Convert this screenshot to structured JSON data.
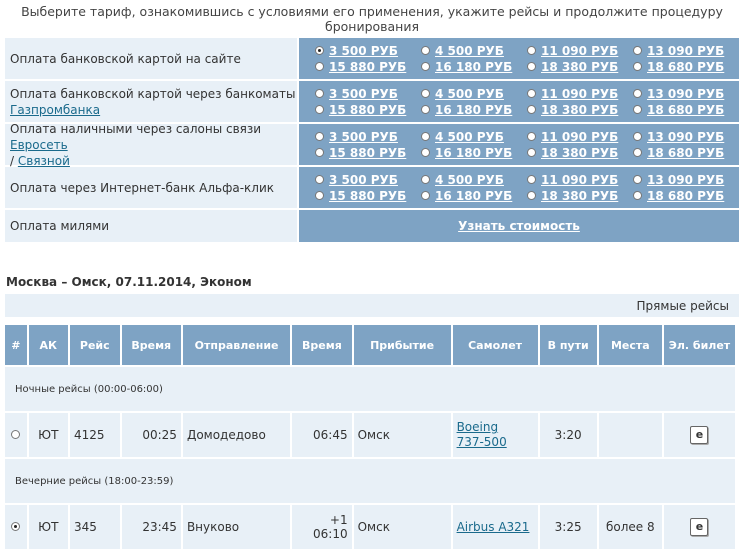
{
  "intro": "Выберите тариф, ознакомившись с условиями его применения, укажите рейсы и продолжите процедуру бронирования",
  "fare_prices": [
    "3 500 РУБ",
    "4 500 РУБ",
    "11 090 РУБ",
    "13 090 РУБ",
    "15 880 РУБ",
    "16 180 РУБ",
    "18 380 РУБ",
    "18 680 РУБ"
  ],
  "payment_options": [
    {
      "label": "Оплата банковской картой на сайте",
      "selected_price_index": 0
    },
    {
      "label": "Оплата банковской картой через банкоматы",
      "link": "Газпромбанка"
    },
    {
      "label": "Оплата наличными через салоны связи",
      "link1": "Евросеть",
      "sep": " /",
      "link2": "Связной"
    },
    {
      "label": "Оплата через Интернет-банк Альфа-клик"
    }
  ],
  "miles": {
    "label": "Оплата милями",
    "link": "Узнать стоимость"
  },
  "route_title": "Москва – Омск, 07.11.2014, Эконом",
  "direct_flights": "Прямые рейсы",
  "columns": [
    "#",
    "АК",
    "Рейс",
    "Время",
    "Отправление",
    "Время",
    "Прибытие",
    "Самолет",
    "В пути",
    "Места",
    "Эл. билет"
  ],
  "groups": [
    {
      "title": "Ночные рейсы (00:00-06:00)",
      "flight": {
        "selected": false,
        "airline": "ЮТ",
        "number": "4125",
        "dep_time": "00:25",
        "dep_airport": "Домодедово",
        "arr_time": "06:45",
        "arr_city": "Омск",
        "plane_line1": "Boeing",
        "plane_line2": "737-500",
        "duration": "3:20",
        "seats": "",
        "eticket": "e"
      }
    },
    {
      "title": "Вечерние рейсы (18:00-23:59)",
      "flight": {
        "selected": true,
        "airline": "ЮТ",
        "number": "345",
        "dep_time": "23:45",
        "dep_airport": "Внуково",
        "arr_time": "+1 06:10",
        "arr_city": "Омск",
        "plane_line1": "Airbus A321",
        "plane_line2": "",
        "duration": "3:25",
        "seats": "более 8",
        "eticket": "e"
      }
    }
  ]
}
